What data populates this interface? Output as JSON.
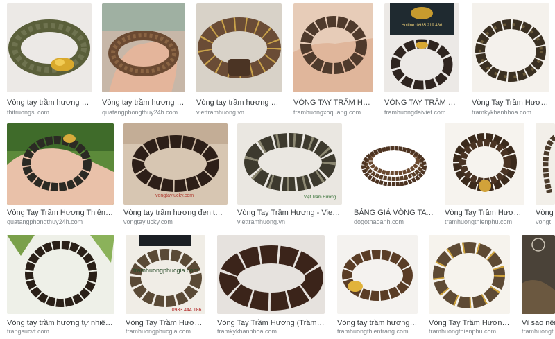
{
  "results": [
    {
      "title": "Vòng tay trầm hương giá sỉ -...",
      "source": "thitruongsi.com"
    },
    {
      "title": "Vòng tay trầm hương thiên n...",
      "source": "quatangphongthuy24h.com"
    },
    {
      "title": "Vòng tay trầm hương bọc vá...",
      "source": "viettramhuong.vn"
    },
    {
      "title": "VÒNG TAY TRẦM HƯƠN...",
      "source": "tramhuongxoquang.com"
    },
    {
      "title": "VÒNG TAY TRẦM HƯƠN...",
      "source": "tramhuongdaiviet.com",
      "overlay": "Hotline: 0935.219.486"
    },
    {
      "title": "Vòng Tay Trầm Hương (Tr...",
      "source": "tramkykhanhhoa.com"
    },
    {
      "title": "Vòng Tay Trầm Hương Thiên Nhiên ...",
      "source": "quatangphongthuy24h.com"
    },
    {
      "title": "Vòng tay trầm hương đen tự nhiên...",
      "source": "vongtaylucky.com",
      "overlay": "vongtaylucky.com"
    },
    {
      "title": "Vòng Tay Trầm Hương - VietTramHu...",
      "source": "viettramhuong.vn",
      "overlay": "Việt Trầm Hương"
    },
    {
      "title": "BẢNG GIÁ VÒNG TAY GỖ ...",
      "source": "dogothaoanh.com"
    },
    {
      "title": "Vòng Tay Trầm Hương Hạt ...",
      "source": "tramhuongthienphu.com"
    },
    {
      "title": "Vòng T",
      "source": "vongt"
    },
    {
      "title": "Vòng tay trầm hương tự nhiên chìm n...",
      "source": "trangsucvt.com"
    },
    {
      "title": "Vòng Tay Trầm Hương Cao...",
      "source": "tramhuongphucgia.com",
      "overlay": "tramhuongphucgia.com",
      "overlay2": "0933 444 186"
    },
    {
      "title": "Vòng Tay Trầm Hương (Trầm Chìm) T...",
      "source": "tramkykhanhhoa.com"
    },
    {
      "title": "Vòng tay trầm hương tự nhi...",
      "source": "tramhuongthientrang.com"
    },
    {
      "title": "Vòng Tay Trầm Hương Trúc...",
      "source": "tramhuongthienphu.com"
    },
    {
      "title": "Vì sao nên c",
      "source": "tramhuongtun"
    }
  ],
  "colors": {
    "title": "#3c4043",
    "source": "#80868b"
  }
}
